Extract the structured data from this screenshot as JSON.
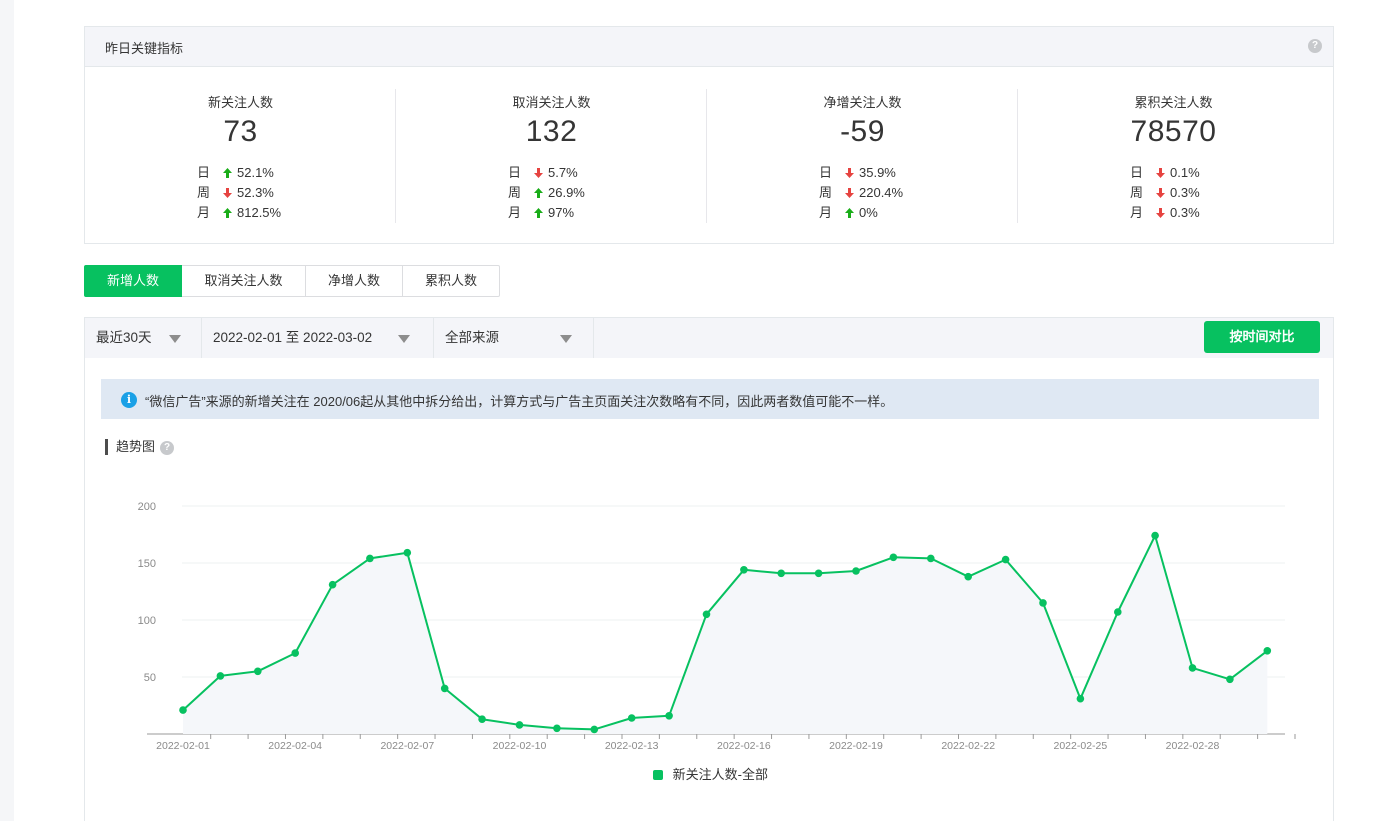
{
  "kpi": {
    "title": "昨日关键指标",
    "help_icon": "?",
    "cards": [
      {
        "label": "新关注人数",
        "value": "73",
        "rows": [
          {
            "period": "日",
            "dir": "up",
            "pct": "52.1%"
          },
          {
            "period": "周",
            "dir": "down",
            "pct": "52.3%"
          },
          {
            "period": "月",
            "dir": "up",
            "pct": "812.5%"
          }
        ]
      },
      {
        "label": "取消关注人数",
        "value": "132",
        "rows": [
          {
            "period": "日",
            "dir": "down",
            "pct": "5.7%"
          },
          {
            "period": "周",
            "dir": "up",
            "pct": "26.9%"
          },
          {
            "period": "月",
            "dir": "up",
            "pct": "97%"
          }
        ]
      },
      {
        "label": "净增关注人数",
        "value": "-59",
        "rows": [
          {
            "period": "日",
            "dir": "down",
            "pct": "35.9%"
          },
          {
            "period": "周",
            "dir": "down",
            "pct": "220.4%"
          },
          {
            "period": "月",
            "dir": "up",
            "pct": "0%"
          }
        ]
      },
      {
        "label": "累积关注人数",
        "value": "78570",
        "rows": [
          {
            "period": "日",
            "dir": "down",
            "pct": "0.1%"
          },
          {
            "period": "周",
            "dir": "down",
            "pct": "0.3%"
          },
          {
            "period": "月",
            "dir": "down",
            "pct": "0.3%"
          }
        ]
      }
    ]
  },
  "colors": {
    "up": "#1aad19",
    "down": "#e64340",
    "accent": "#07c160"
  },
  "tabs": [
    "新增人数",
    "取消关注人数",
    "净增人数",
    "累积人数"
  ],
  "active_tab": 0,
  "filters": {
    "range": "最近30天",
    "dates": "2022-02-01 至 2022-03-02",
    "source": "全部来源",
    "compare_button": "按时间对比"
  },
  "notice": "“微信广告”来源的新增关注在 2020/06起从其他中拆分给出，计算方式与广告主页面关注次数略有不同，因此两者数值可能不一样。",
  "trend_title": "趋势图",
  "chart_data": {
    "type": "area",
    "x": [
      "2022-02-01",
      "2022-02-02",
      "2022-02-03",
      "2022-02-04",
      "2022-02-05",
      "2022-02-06",
      "2022-02-07",
      "2022-02-08",
      "2022-02-09",
      "2022-02-10",
      "2022-02-11",
      "2022-02-12",
      "2022-02-13",
      "2022-02-14",
      "2022-02-15",
      "2022-02-16",
      "2022-02-17",
      "2022-02-18",
      "2022-02-19",
      "2022-02-20",
      "2022-02-21",
      "2022-02-22",
      "2022-02-23",
      "2022-02-24",
      "2022-02-25",
      "2022-02-26",
      "2022-02-27",
      "2022-02-28",
      "2022-03-01",
      "2022-03-02"
    ],
    "xticks": [
      "2022-02-01",
      "2022-02-04",
      "2022-02-07",
      "2022-02-10",
      "2022-02-13",
      "2022-02-16",
      "2022-02-19",
      "2022-02-22",
      "2022-02-25",
      "2022-02-28"
    ],
    "series": [
      {
        "name": "新关注人数-全部",
        "color": "#07c160",
        "values": [
          21,
          51,
          55,
          71,
          131,
          154,
          159,
          40,
          13,
          8,
          5,
          4,
          14,
          16,
          105,
          144,
          141,
          141,
          143,
          155,
          154,
          138,
          153,
          115,
          31,
          107,
          174,
          58,
          48,
          73
        ]
      }
    ],
    "yticks": [
      50,
      100,
      150,
      200
    ],
    "ylim": [
      0,
      200
    ],
    "grid": true,
    "legend": "bottom-center"
  }
}
